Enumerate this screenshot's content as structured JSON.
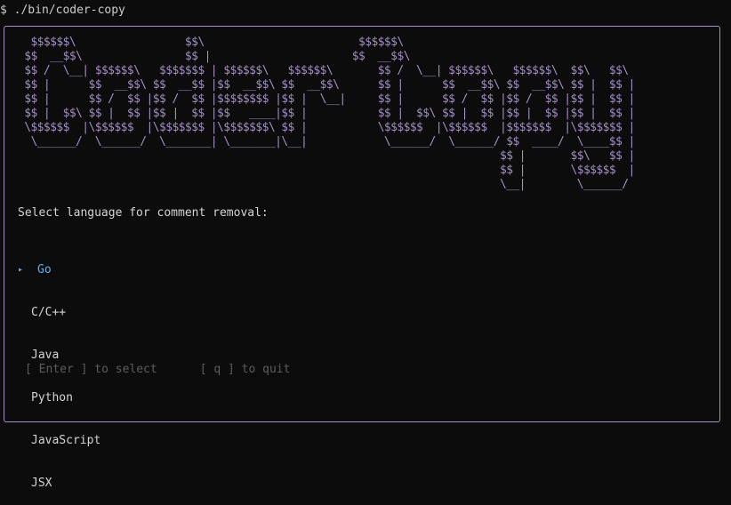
{
  "terminal": {
    "prompt": "$ ./bin/coder-copy"
  },
  "banner": {
    "ascii_art": "  $$$$$$\\                 $$\\                        $$$$$$\\\n $$  __$$\\                $$ |                      $$  __$$\\\n $$ /  \\__| $$$$$$\\   $$$$$$$ | $$$$$$\\   $$$$$$\\       $$ /  \\__| $$$$$$\\   $$$$$$\\  $$\\   $$\\\n $$ |      $$  __$$\\ $$  __$$ |$$  __$$\\ $$  __$$\\      $$ |      $$  __$$\\ $$  __$$\\ $$ |  $$ |\n $$ |      $$ /  $$ |$$ /  $$ |$$$$$$$$ |$$ |  \\__|     $$ |      $$ /  $$ |$$ /  $$ |$$ |  $$ |\n $$ |  $$\\ $$ |  $$ |$$ |  $$ |$$   ____|$$ |           $$ |  $$\\ $$ |  $$ |$$ |  $$ |$$ |  $$ |\n \\$$$$$$  |\\$$$$$$  |\\$$$$$$$ |\\$$$$$$$\\ $$ |           \\$$$$$$  |\\$$$$$$  |$$$$$$$  |\\$$$$$$$ |\n  \\______/  \\______/  \\_______| \\_______|\\__|            \\______/  \\______/ $$  ____/  \\____$$ |\n                                                                           $$ |       $$\\   $$ |\n                                                                           $$ |       \\$$$$$$  |\n                                                                           \\__|        \\______/"
  },
  "prompt_text": "Select language for comment removal:",
  "menu": {
    "cursor_glyph": "▸",
    "items": [
      {
        "label": "Go"
      },
      {
        "label": "C/C++"
      },
      {
        "label": "Java"
      },
      {
        "label": "Python"
      },
      {
        "label": "JavaScript"
      },
      {
        "label": "JSX"
      }
    ]
  },
  "footer": {
    "select_hint": "[ Enter ] to select",
    "quit_hint": "[ q ] to quit"
  },
  "colors": {
    "accent": "#a58fc6",
    "selected": "#61afef",
    "text": "#d4d4d4",
    "muted": "#5c5c5c",
    "background": "#0c0c0c"
  }
}
